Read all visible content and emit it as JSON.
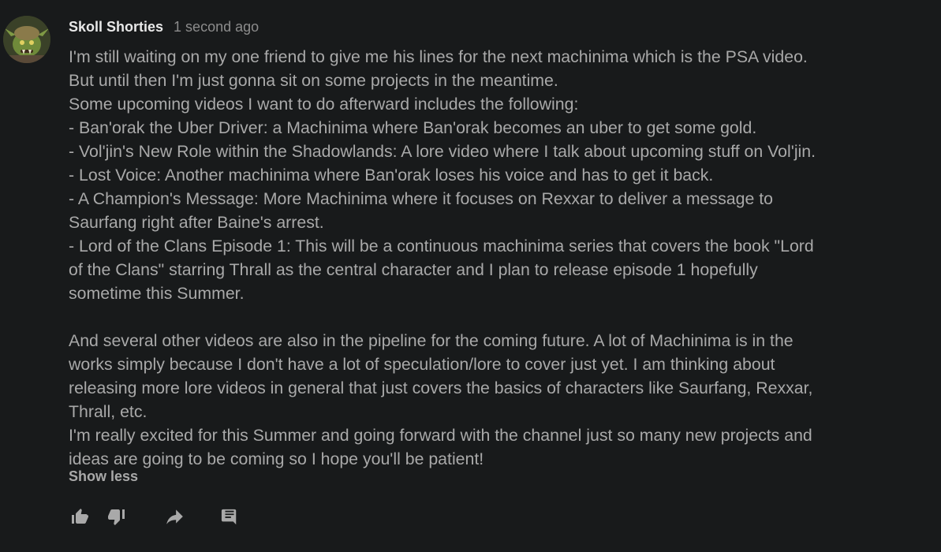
{
  "comment": {
    "author": "Skoll Shorties",
    "time": "1 second ago",
    "lines": [
      "I'm still waiting on my one friend to give me his lines for the next machinima which is the PSA video.",
      "But until then I'm just gonna sit on some projects in the meantime.",
      "Some upcoming videos I want to do afterward includes the following:",
      "- Ban'orak the Uber Driver: a Machinima where Ban'orak becomes an uber to get some gold.",
      "- Vol'jin's New Role within the Shadowlands: A lore video where I talk about upcoming stuff on Vol'jin.",
      "- Lost Voice: Another machinima where Ban'orak loses his voice and has to get it back.",
      "- A Champion's Message: More Machinima where it focuses on Rexxar to deliver a message to",
      "Saurfang right after Baine's arrest.",
      "- Lord of the Clans Episode 1: This will be a continuous machinima series that covers the book \"Lord",
      "of the Clans\" starring Thrall as the central character and I plan to release episode 1 hopefully",
      "sometime this Summer.",
      "",
      "And several other videos are also in the pipeline for the coming future. A lot of Machinima is in the",
      "works simply because I don't have a lot of speculation/lore to cover just yet. I am thinking about",
      "releasing more lore videos in general that just covers the basics of characters like Saurfang, Rexxar,",
      "Thrall, etc.",
      "I'm really excited for this Summer and going forward with the channel just so many new projects and",
      "ideas are going to be coming so I hope you'll be patient!"
    ],
    "show_less_label": "Show less"
  },
  "actions": {
    "icons": [
      "thumbs-up-icon",
      "thumbs-down-icon",
      "share-icon",
      "reply-icon"
    ]
  },
  "colors": {
    "background": "#181a1b",
    "author_text": "#e8e8e8",
    "body_text": "#a9a9a9",
    "icon": "#a9a9a9"
  }
}
